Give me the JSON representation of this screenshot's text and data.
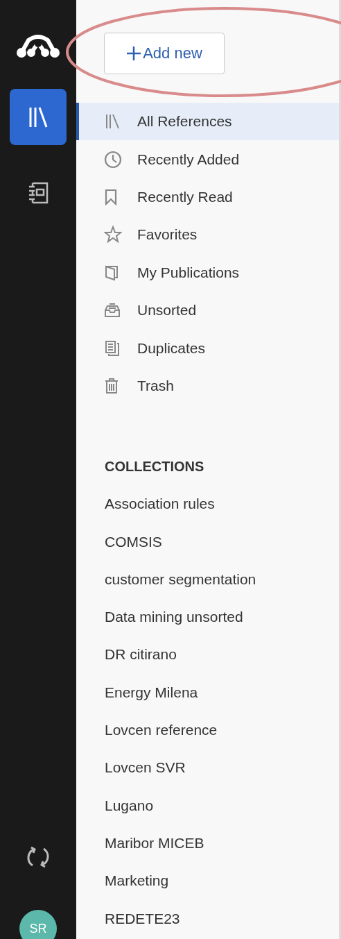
{
  "rail": {
    "items": [
      {
        "kind": "library",
        "selected": true
      },
      {
        "kind": "notebook",
        "selected": false
      }
    ],
    "avatar": {
      "initials": "SR"
    }
  },
  "add_button": {
    "label": "Add new"
  },
  "library": [
    {
      "label": "All References",
      "kind": "all",
      "selected": true
    },
    {
      "label": "Recently Added",
      "kind": "clock",
      "selected": false
    },
    {
      "label": "Recently Read",
      "kind": "bookmark",
      "selected": false
    },
    {
      "label": "Favorites",
      "kind": "star",
      "selected": false
    },
    {
      "label": "My Publications",
      "kind": "book",
      "selected": false
    },
    {
      "label": "Unsorted",
      "kind": "inbox",
      "selected": false
    },
    {
      "label": "Duplicates",
      "kind": "duplicate",
      "selected": false
    },
    {
      "label": "Trash",
      "kind": "trash",
      "selected": false
    }
  ],
  "collections": {
    "heading": "COLLECTIONS",
    "items": [
      "Association rules",
      "COMSIS",
      "customer segmentation",
      "Data mining unsorted",
      "DR citirano",
      "Energy Milena",
      "Lovcen reference",
      "Lovcen SVR",
      "Lugano",
      "Maribor MICEB",
      "Marketing",
      "REDETE23"
    ]
  }
}
